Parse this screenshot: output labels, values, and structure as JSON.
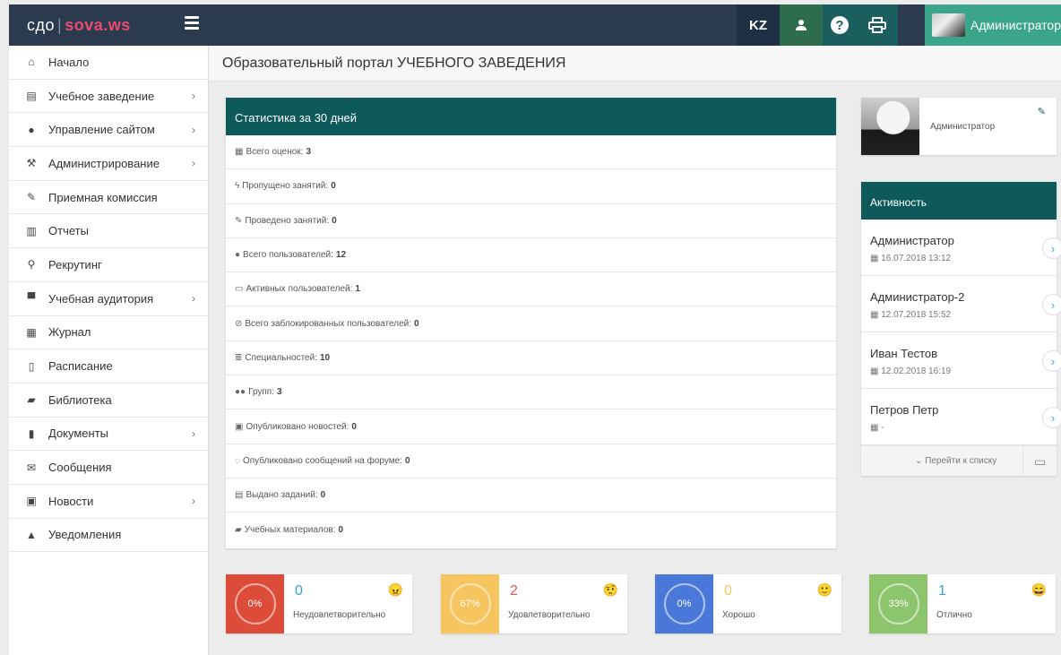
{
  "topbar": {
    "logo_prefix": "сдо",
    "logo_sep": "|",
    "logo_main": "sova",
    "logo_tld": ".ws",
    "lang_label": "KZ",
    "user_name": "Администратор",
    "icons": [
      "menu-icon",
      "user-icon",
      "help-icon",
      "print-icon"
    ],
    "colors": {
      "bar": "#2b3a4f",
      "user_button": "#3ba58a",
      "teal": "#1a5e5e"
    }
  },
  "sidebar": {
    "items": [
      {
        "label": "Начало",
        "icon": "home-icon",
        "has_submenu": false
      },
      {
        "label": "Учебное заведение",
        "icon": "building-icon",
        "has_submenu": true
      },
      {
        "label": "Управление сайтом",
        "icon": "globe-icon",
        "has_submenu": true
      },
      {
        "label": "Администрирование",
        "icon": "admin-icon",
        "has_submenu": true
      },
      {
        "label": "Приемная комиссия",
        "icon": "pencil-icon",
        "has_submenu": false
      },
      {
        "label": "Отчеты",
        "icon": "bar-chart-icon",
        "has_submenu": false
      },
      {
        "label": "Рекрутинг",
        "icon": "search-icon",
        "has_submenu": false
      },
      {
        "label": "Учебная аудитория",
        "icon": "presentation-icon",
        "has_submenu": true
      },
      {
        "label": "Журнал",
        "icon": "table-icon",
        "has_submenu": false
      },
      {
        "label": "Расписание",
        "icon": "calendar-icon",
        "has_submenu": false
      },
      {
        "label": "Библиотека",
        "icon": "book-icon",
        "has_submenu": false
      },
      {
        "label": "Документы",
        "icon": "document-icon",
        "has_submenu": true
      },
      {
        "label": "Сообщения",
        "icon": "envelope-icon",
        "has_submenu": false
      },
      {
        "label": "Новости",
        "icon": "newspaper-icon",
        "has_submenu": true
      },
      {
        "label": "Уведомления",
        "icon": "warning-icon",
        "has_submenu": false
      }
    ]
  },
  "page": {
    "title": "Образовательный портал УЧЕБНОГО ЗАВЕДЕНИЯ"
  },
  "stats": {
    "title": "Статистика за 30 дней",
    "rows": [
      {
        "icon": "grid-icon",
        "label": "Всего оценок:",
        "value": "3"
      },
      {
        "icon": "bolt-icon",
        "label": "Пропущено занятий:",
        "value": "0"
      },
      {
        "icon": "pencil-icon",
        "label": "Проведено занятий:",
        "value": "0"
      },
      {
        "icon": "user-icon",
        "label": "Всего пользователей:",
        "value": "12"
      },
      {
        "icon": "network-icon",
        "label": "Активных пользователей:",
        "value": "1"
      },
      {
        "icon": "ban-icon",
        "label": "Всего заблокированных пользователей:",
        "value": "0"
      },
      {
        "icon": "list-icon",
        "label": "Специальностей:",
        "value": "10"
      },
      {
        "icon": "group-icon",
        "label": "Групп:",
        "value": "3"
      },
      {
        "icon": "newspaper-icon",
        "label": "Опубликовано новостей:",
        "value": "0"
      },
      {
        "icon": "comments-icon",
        "label": "Опубликовано сообщений на форуме:",
        "value": "0"
      },
      {
        "icon": "list-alt-icon",
        "label": "Выдано заданий:",
        "value": "0"
      },
      {
        "icon": "book-icon",
        "label": "Учебных материалов:",
        "value": "0"
      }
    ]
  },
  "profile": {
    "name": "Администратор"
  },
  "activity": {
    "title": "Активность",
    "items": [
      {
        "name": "Администратор",
        "date": "16.07.2018 13:12"
      },
      {
        "name": "Администратор-2",
        "date": "12.07.2018 15:52"
      },
      {
        "name": "Иван Тестов",
        "date": "12.02.2018 16:19"
      },
      {
        "name": "Петров Петр",
        "date": "-"
      }
    ],
    "footer_link": "Перейти к списку"
  },
  "grades": [
    {
      "percent": 0,
      "percent_label": "0%",
      "count": "0",
      "label": "Неудовлетворительно",
      "color": "#dd4b39",
      "emoji": "😠",
      "num_color": "#3aa3d8"
    },
    {
      "percent": 67,
      "percent_label": "67%",
      "count": "2",
      "label": "Удовлетворительно",
      "color": "#f7c55f",
      "emoji": "🤨",
      "num_color": "#e05a4f"
    },
    {
      "percent": 0,
      "percent_label": "0%",
      "count": "0",
      "label": "Хорошо",
      "color": "#4a78d8",
      "emoji": "🙂",
      "num_color": "#f7c55f"
    },
    {
      "percent": 33,
      "percent_label": "33%",
      "count": "1",
      "label": "Отлично",
      "color": "#8cc56c",
      "emoji": "😄",
      "num_color": "#3aa3d8"
    }
  ]
}
